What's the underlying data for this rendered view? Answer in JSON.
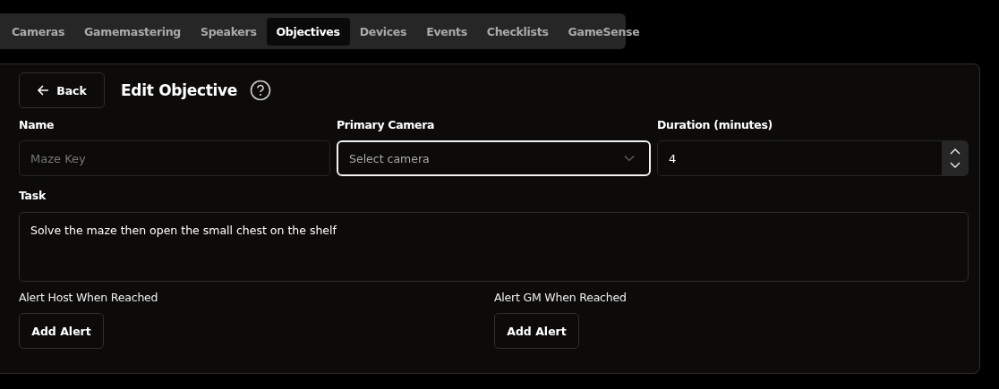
{
  "tabs": [
    {
      "label": "Cameras",
      "selected": false
    },
    {
      "label": "Gamemastering",
      "selected": false
    },
    {
      "label": "Speakers",
      "selected": false
    },
    {
      "label": "Objectives",
      "selected": true
    },
    {
      "label": "Devices",
      "selected": false
    },
    {
      "label": "Events",
      "selected": false
    },
    {
      "label": "Checklists",
      "selected": false
    },
    {
      "label": "GameSense",
      "selected": false
    }
  ],
  "back_button": "Back",
  "title": "Edit Objective",
  "fields": [
    {
      "label": "Name",
      "kind": "text",
      "placeholder": "Maze Key",
      "focused": false
    },
    {
      "label": "Primary Camera",
      "kind": "select",
      "placeholder": "Select camera",
      "focused": true
    },
    {
      "label": "Duration (minutes)",
      "kind": "number",
      "value": "4",
      "focused": false
    }
  ],
  "task": {
    "label": "Task",
    "value": "Solve the maze then open the small chest on the shelf"
  },
  "alerts": [
    {
      "label": "Alert Host When Reached",
      "button": "Add Alert"
    },
    {
      "label": "Alert GM When Reached",
      "button": "Add Alert"
    }
  ]
}
